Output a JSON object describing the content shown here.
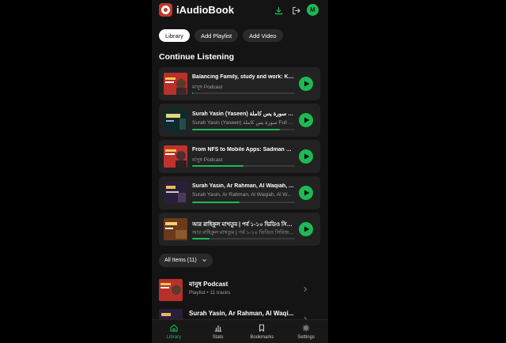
{
  "app": {
    "title": "iAudioBook",
    "avatar_initial": "M"
  },
  "colors": {
    "accent": "#1db954",
    "background": "#141414",
    "card": "#222222",
    "muted": "#a0a0a0"
  },
  "header_icons": [
    "download-icon",
    "logout-icon"
  ],
  "tabs": [
    {
      "label": "Library",
      "active": true
    },
    {
      "label": "Add Playlist",
      "active": false
    },
    {
      "label": "Add Video",
      "active": false
    }
  ],
  "continue_listening": {
    "title": "Continue Listening",
    "items": [
      {
        "title": "Balancing Family, study and work: Kha...",
        "subtitle": "মানুষ Podcast",
        "progress": 0.01
      },
      {
        "title": "Surah Yasin (Yaseen) سورة يس كاملة Full ...",
        "subtitle": "Surah Yasin (Yaseen) سورة يس كاملة Full wi...",
        "progress": 0.85
      },
      {
        "title": "From NFS to Mobile Apps: Sadman Sa...",
        "subtitle": "মানুষ Podcast",
        "progress": 0.5
      },
      {
        "title": "Surah Yasin, Ar Rahman, Al Waqiah, Al ...",
        "subtitle": "Surah Yasin, Ar Rahman, Al Waqiah, Al W...",
        "progress": 0.46
      },
      {
        "title": "আর রাহিকুল মাখতুম | পর্ব ১-১০ ভিডিও সিরিজ ...",
        "subtitle": "আর রাহিকুল মাখতুম | পর্ব ১-১০ ভিডিও সিরিজ |...",
        "progress": 0.17
      }
    ]
  },
  "filter": {
    "label": "All Items (11)"
  },
  "playlists": [
    {
      "title": "মানুষ Podcast",
      "subtitle": "Playlist • 11 tracks"
    },
    {
      "title": "Surah Yasin, Ar Rahman, Al Waqi...",
      "subtitle": ""
    }
  ],
  "bottom_nav": [
    {
      "label": "Library",
      "icon": "home-icon",
      "active": true
    },
    {
      "label": "Stats",
      "icon": "bar-chart-icon",
      "active": false
    },
    {
      "label": "Bookmarks",
      "icon": "bookmark-icon",
      "active": false
    },
    {
      "label": "Settings",
      "icon": "gear-icon",
      "active": false
    }
  ]
}
